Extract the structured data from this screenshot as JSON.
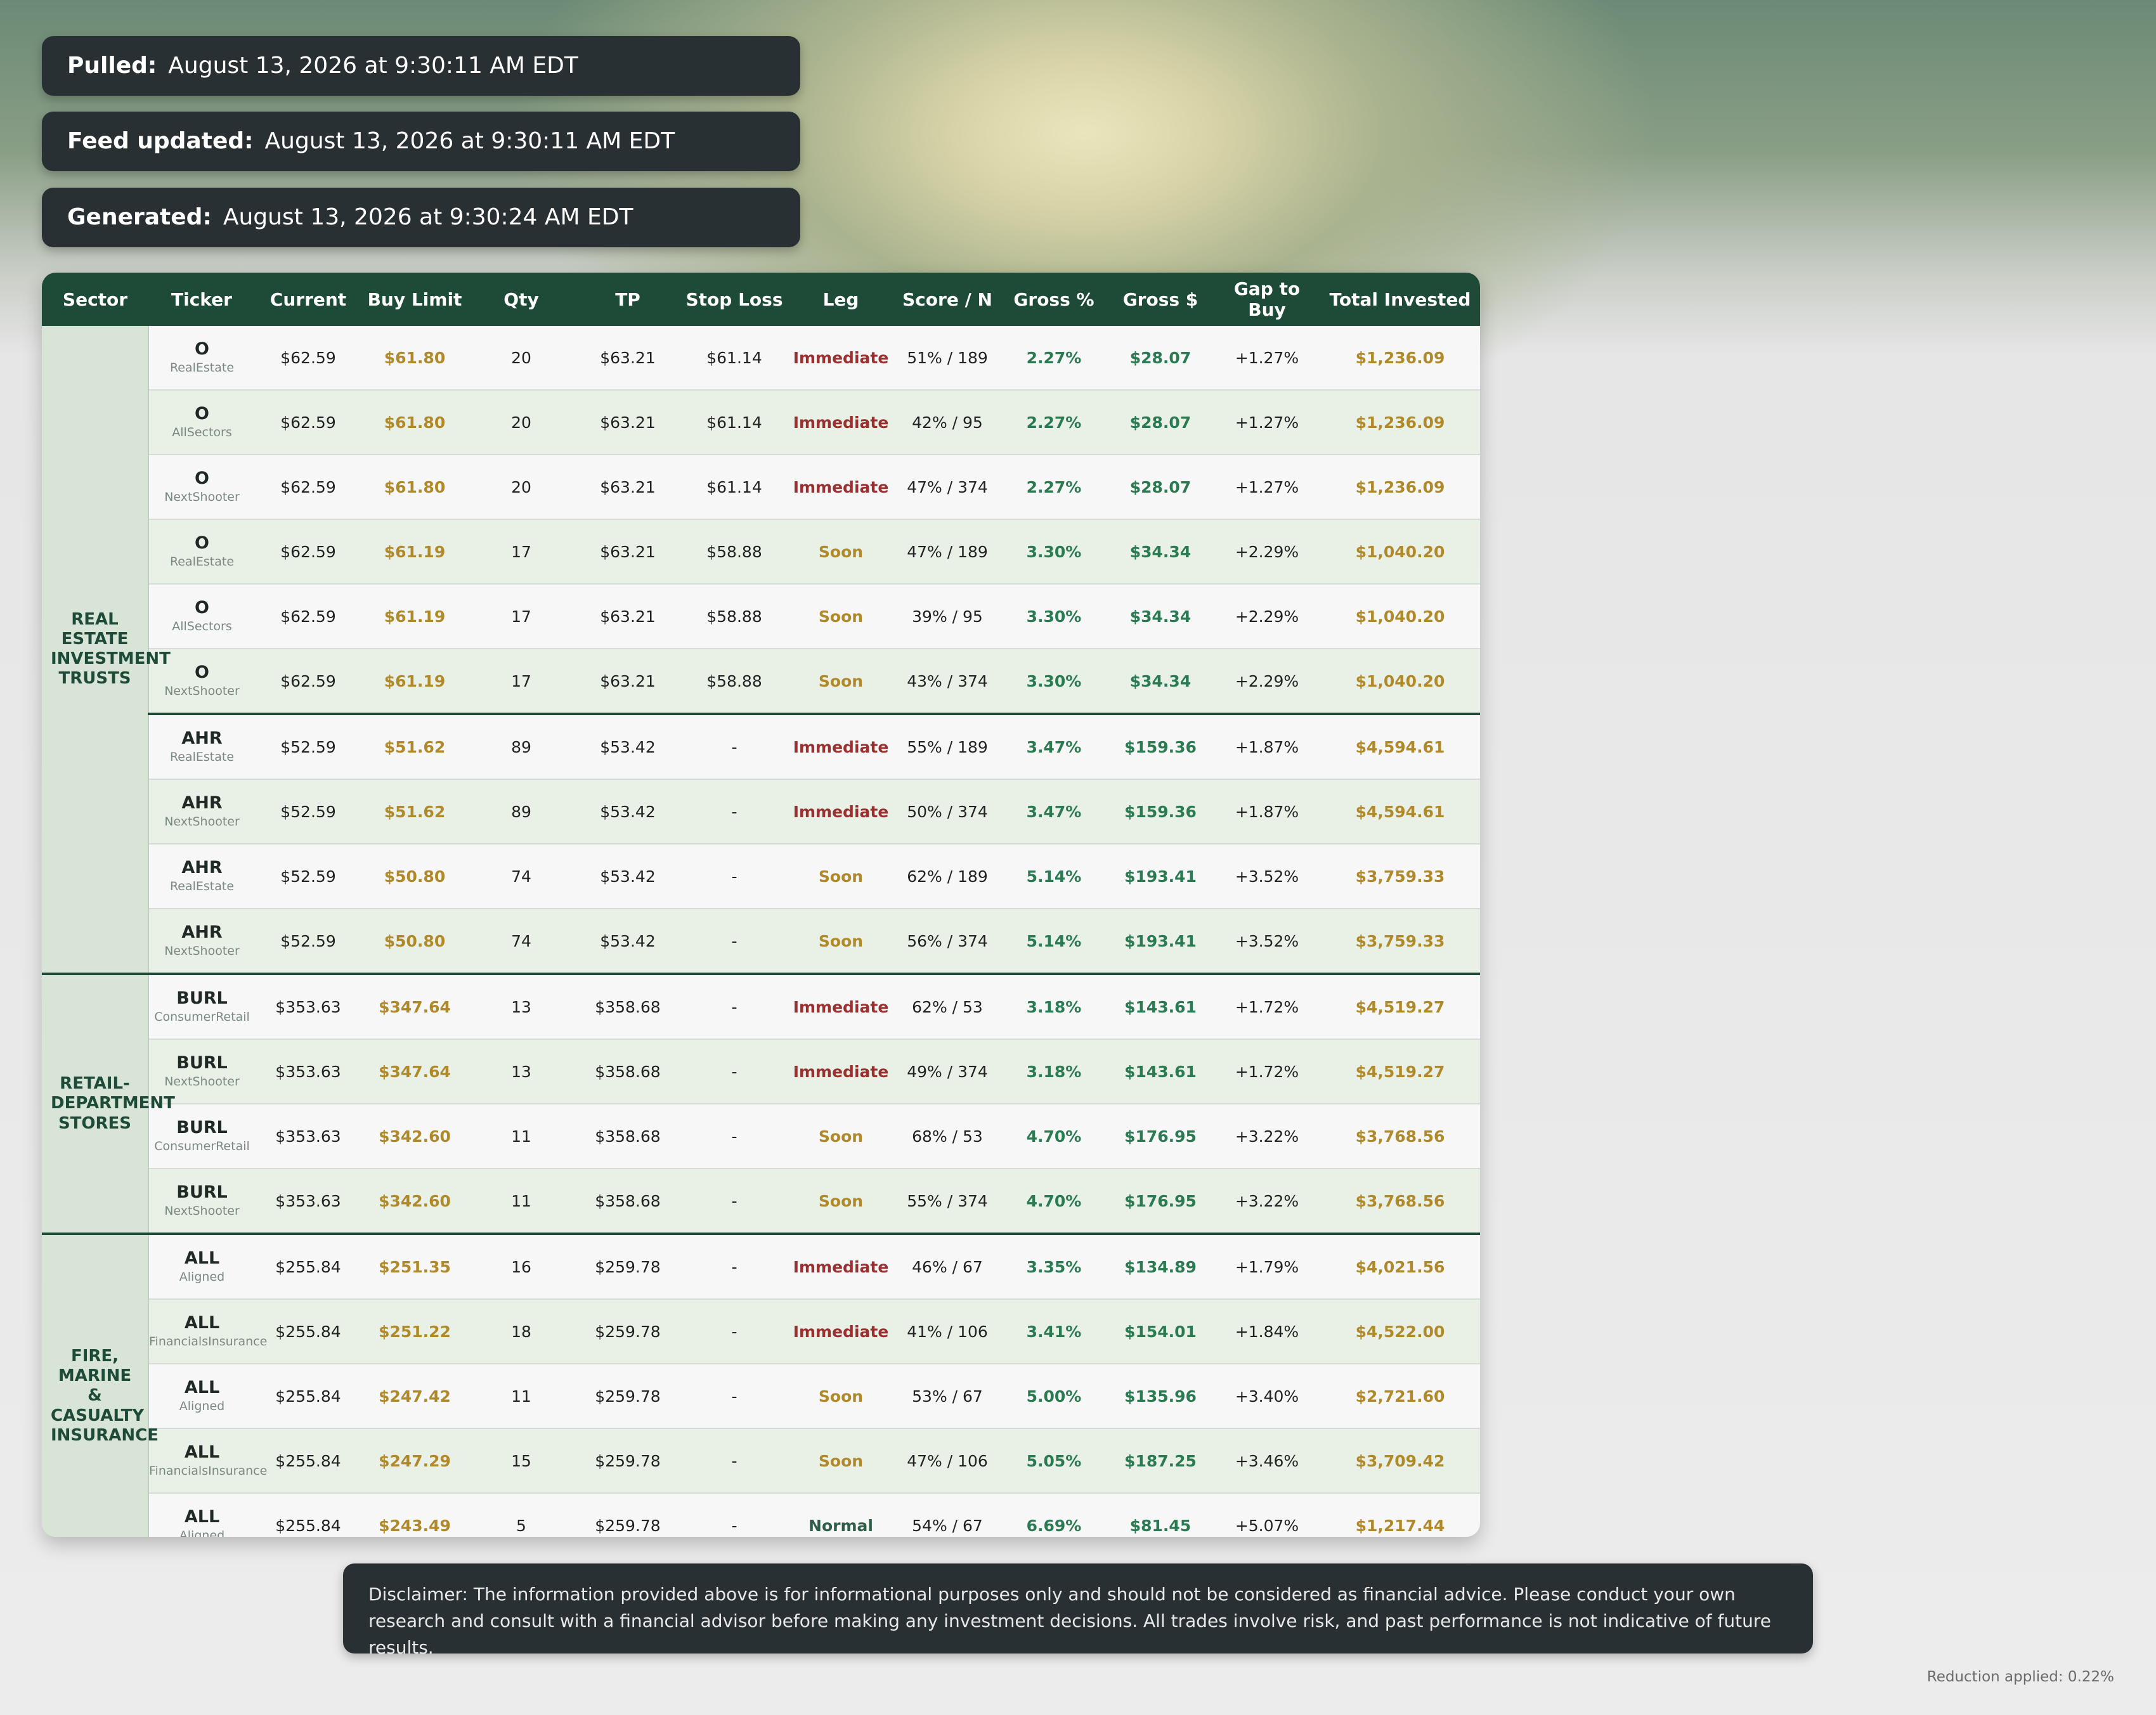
{
  "header": {
    "pulled": {
      "label": "Pulled:",
      "value": "August 13, 2026 at 9:30:11 AM EDT"
    },
    "feed_updated": {
      "label": "Feed updated:",
      "value": "August 13, 2026 at 9:30:11 AM EDT"
    },
    "generated": {
      "label": "Generated:",
      "value": "August 13, 2026 at 9:30:24 AM EDT"
    }
  },
  "table": {
    "columns": [
      "Sector",
      "Ticker",
      "Current",
      "Buy Limit",
      "Qty",
      "TP",
      "Stop Loss",
      "Leg",
      "Score / N",
      "Gross %",
      "Gross $",
      "Gap to Buy",
      "Total Invested"
    ],
    "groups": [
      {
        "sector": "REAL ESTATE INVESTMENT TRUSTS",
        "rows": [
          {
            "ticker": "O",
            "source": "RealEstate",
            "current": "$62.59",
            "buy_limit": "$61.80",
            "qty": "20",
            "tp": "$63.21",
            "stop_loss": "$61.14",
            "leg": "Immediate",
            "score": "51% / 189",
            "gross_pct": "2.27%",
            "gross_usd": "$28.07",
            "gap": "+1.27%",
            "total": "$1,236.09"
          },
          {
            "ticker": "O",
            "source": "AllSectors",
            "current": "$62.59",
            "buy_limit": "$61.80",
            "qty": "20",
            "tp": "$63.21",
            "stop_loss": "$61.14",
            "leg": "Immediate",
            "score": "42% / 95",
            "gross_pct": "2.27%",
            "gross_usd": "$28.07",
            "gap": "+1.27%",
            "total": "$1,236.09"
          },
          {
            "ticker": "O",
            "source": "NextShooter",
            "current": "$62.59",
            "buy_limit": "$61.80",
            "qty": "20",
            "tp": "$63.21",
            "stop_loss": "$61.14",
            "leg": "Immediate",
            "score": "47% / 374",
            "gross_pct": "2.27%",
            "gross_usd": "$28.07",
            "gap": "+1.27%",
            "total": "$1,236.09"
          },
          {
            "ticker": "O",
            "source": "RealEstate",
            "current": "$62.59",
            "buy_limit": "$61.19",
            "qty": "17",
            "tp": "$63.21",
            "stop_loss": "$58.88",
            "leg": "Soon",
            "score": "47% / 189",
            "gross_pct": "3.30%",
            "gross_usd": "$34.34",
            "gap": "+2.29%",
            "total": "$1,040.20"
          },
          {
            "ticker": "O",
            "source": "AllSectors",
            "current": "$62.59",
            "buy_limit": "$61.19",
            "qty": "17",
            "tp": "$63.21",
            "stop_loss": "$58.88",
            "leg": "Soon",
            "score": "39% / 95",
            "gross_pct": "3.30%",
            "gross_usd": "$34.34",
            "gap": "+2.29%",
            "total": "$1,040.20"
          },
          {
            "ticker": "O",
            "source": "NextShooter",
            "current": "$62.59",
            "buy_limit": "$61.19",
            "qty": "17",
            "tp": "$63.21",
            "stop_loss": "$58.88",
            "leg": "Soon",
            "score": "43% / 374",
            "gross_pct": "3.30%",
            "gross_usd": "$34.34",
            "gap": "+2.29%",
            "total": "$1,040.20"
          },
          {
            "ticker": "AHR",
            "source": "RealEstate",
            "current": "$52.59",
            "buy_limit": "$51.62",
            "qty": "89",
            "tp": "$53.42",
            "stop_loss": "-",
            "leg": "Immediate",
            "score": "55% / 189",
            "gross_pct": "3.47%",
            "gross_usd": "$159.36",
            "gap": "+1.87%",
            "total": "$4,594.61",
            "ticker_break": true
          },
          {
            "ticker": "AHR",
            "source": "NextShooter",
            "current": "$52.59",
            "buy_limit": "$51.62",
            "qty": "89",
            "tp": "$53.42",
            "stop_loss": "-",
            "leg": "Immediate",
            "score": "50% / 374",
            "gross_pct": "3.47%",
            "gross_usd": "$159.36",
            "gap": "+1.87%",
            "total": "$4,594.61"
          },
          {
            "ticker": "AHR",
            "source": "RealEstate",
            "current": "$52.59",
            "buy_limit": "$50.80",
            "qty": "74",
            "tp": "$53.42",
            "stop_loss": "-",
            "leg": "Soon",
            "score": "62% / 189",
            "gross_pct": "5.14%",
            "gross_usd": "$193.41",
            "gap": "+3.52%",
            "total": "$3,759.33"
          },
          {
            "ticker": "AHR",
            "source": "NextShooter",
            "current": "$52.59",
            "buy_limit": "$50.80",
            "qty": "74",
            "tp": "$53.42",
            "stop_loss": "-",
            "leg": "Soon",
            "score": "56% / 374",
            "gross_pct": "5.14%",
            "gross_usd": "$193.41",
            "gap": "+3.52%",
            "total": "$3,759.33"
          }
        ]
      },
      {
        "sector": "RETAIL-DEPARTMENT STORES",
        "rows": [
          {
            "ticker": "BURL",
            "source": "ConsumerRetail",
            "current": "$353.63",
            "buy_limit": "$347.64",
            "qty": "13",
            "tp": "$358.68",
            "stop_loss": "-",
            "leg": "Immediate",
            "score": "62% / 53",
            "gross_pct": "3.18%",
            "gross_usd": "$143.61",
            "gap": "+1.72%",
            "total": "$4,519.27"
          },
          {
            "ticker": "BURL",
            "source": "NextShooter",
            "current": "$353.63",
            "buy_limit": "$347.64",
            "qty": "13",
            "tp": "$358.68",
            "stop_loss": "-",
            "leg": "Immediate",
            "score": "49% / 374",
            "gross_pct": "3.18%",
            "gross_usd": "$143.61",
            "gap": "+1.72%",
            "total": "$4,519.27"
          },
          {
            "ticker": "BURL",
            "source": "ConsumerRetail",
            "current": "$353.63",
            "buy_limit": "$342.60",
            "qty": "11",
            "tp": "$358.68",
            "stop_loss": "-",
            "leg": "Soon",
            "score": "68% / 53",
            "gross_pct": "4.70%",
            "gross_usd": "$176.95",
            "gap": "+3.22%",
            "total": "$3,768.56"
          },
          {
            "ticker": "BURL",
            "source": "NextShooter",
            "current": "$353.63",
            "buy_limit": "$342.60",
            "qty": "11",
            "tp": "$358.68",
            "stop_loss": "-",
            "leg": "Soon",
            "score": "55% / 374",
            "gross_pct": "4.70%",
            "gross_usd": "$176.95",
            "gap": "+3.22%",
            "total": "$3,768.56"
          }
        ]
      },
      {
        "sector": "FIRE, MARINE & CASUALTY INSURANCE",
        "rows": [
          {
            "ticker": "ALL",
            "source": "Aligned",
            "current": "$255.84",
            "buy_limit": "$251.35",
            "qty": "16",
            "tp": "$259.78",
            "stop_loss": "-",
            "leg": "Immediate",
            "score": "46% / 67",
            "gross_pct": "3.35%",
            "gross_usd": "$134.89",
            "gap": "+1.79%",
            "total": "$4,021.56"
          },
          {
            "ticker": "ALL",
            "source": "FinancialsInsurance",
            "current": "$255.84",
            "buy_limit": "$251.22",
            "qty": "18",
            "tp": "$259.78",
            "stop_loss": "-",
            "leg": "Immediate",
            "score": "41% / 106",
            "gross_pct": "3.41%",
            "gross_usd": "$154.01",
            "gap": "+1.84%",
            "total": "$4,522.00"
          },
          {
            "ticker": "ALL",
            "source": "Aligned",
            "current": "$255.84",
            "buy_limit": "$247.42",
            "qty": "11",
            "tp": "$259.78",
            "stop_loss": "-",
            "leg": "Soon",
            "score": "53% / 67",
            "gross_pct": "5.00%",
            "gross_usd": "$135.96",
            "gap": "+3.40%",
            "total": "$2,721.60"
          },
          {
            "ticker": "ALL",
            "source": "FinancialsInsurance",
            "current": "$255.84",
            "buy_limit": "$247.29",
            "qty": "15",
            "tp": "$259.78",
            "stop_loss": "-",
            "leg": "Soon",
            "score": "47% / 106",
            "gross_pct": "5.05%",
            "gross_usd": "$187.25",
            "gap": "+3.46%",
            "total": "$3,709.42"
          },
          {
            "ticker": "ALL",
            "source": "Aligned",
            "current": "$255.84",
            "buy_limit": "$243.49",
            "qty": "5",
            "tp": "$259.78",
            "stop_loss": "-",
            "leg": "Normal",
            "score": "54% / 67",
            "gross_pct": "6.69%",
            "gross_usd": "$81.45",
            "gap": "+5.07%",
            "total": "$1,217.44"
          }
        ]
      }
    ]
  },
  "disclaimer": "Disclaimer: The information provided above is for informational purposes only and should not be considered as financial advice. Please conduct your own research and consult with a financial advisor before making any investment decisions. All trades involve risk, and past performance is not indicative of future results.",
  "footer": "Reduction applied: 0.22%",
  "colors": {
    "header_bg": "#1e4a38",
    "immediate": "#9a3030",
    "soon": "#b08a2a",
    "normal": "#2f5e48",
    "gross_green": "#2a7a52",
    "gold": "#b08a2a"
  }
}
